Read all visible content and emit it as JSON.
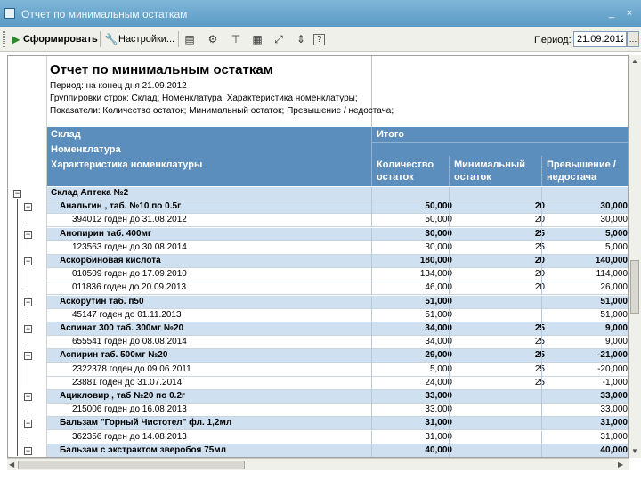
{
  "window": {
    "title": "Отчет по минимальным остаткам",
    "minimize": "_",
    "close": "×"
  },
  "toolbar": {
    "generate_label": "Сформировать",
    "settings_label": "Настройки...",
    "period_label": "Период:",
    "period_value": "21.09.2012"
  },
  "report": {
    "title": "Отчет по минимальным остаткам",
    "period_line": "Период: на конец дня 21.09.2012",
    "grouping_line": "Группировки строк: Склад; Номенклатура; Характеристика номенклатуры;",
    "indicators_line": "Показатели: Количество остаток; Минимальный остаток; Превышение / недостача;",
    "header": {
      "warehouse": "Склад",
      "nomenclature": "Номенклатура",
      "characteristic": "Характеристика номенклатуры",
      "total": "Итого",
      "qty_line1": "Количество",
      "qty_line2": "остаток",
      "min_line1": "Минимальный",
      "min_line2": "остаток",
      "diff_line1": "Превышение /",
      "diff_line2": "недостача"
    },
    "rows": [
      {
        "level": 0,
        "name": "Склад Аптека №2",
        "qty": "",
        "min": "",
        "diff": ""
      },
      {
        "level": 1,
        "name": "Анальгин , таб. №10 по 0.5г",
        "qty": "50,000",
        "min": "20",
        "diff": "30,000"
      },
      {
        "level": 2,
        "name": "394012 годен до 31.08.2012",
        "qty": "50,000",
        "min": "20",
        "diff": "30,000"
      },
      {
        "level": 1,
        "name": "Анопирин таб. 400мг",
        "qty": "30,000",
        "min": "25",
        "diff": "5,000"
      },
      {
        "level": 2,
        "name": "123563 годен до 30.08.2014",
        "qty": "30,000",
        "min": "25",
        "diff": "5,000"
      },
      {
        "level": 1,
        "name": "Аскорбиновая кислота",
        "qty": "180,000",
        "min": "20",
        "diff": "140,000"
      },
      {
        "level": 2,
        "name": "010509 годен до 17.09.2010",
        "qty": "134,000",
        "min": "20",
        "diff": "114,000"
      },
      {
        "level": 2,
        "name": "011836 годен до 20.09.2013",
        "qty": "46,000",
        "min": "20",
        "diff": "26,000"
      },
      {
        "level": 1,
        "name": "Аскорутин таб. п50",
        "qty": "51,000",
        "min": "",
        "diff": "51,000"
      },
      {
        "level": 2,
        "name": "45147 годен до 01.11.2013",
        "qty": "51,000",
        "min": "",
        "diff": "51,000"
      },
      {
        "level": 1,
        "name": "Аспинат 300 таб. 300мг №20",
        "qty": "34,000",
        "min": "25",
        "diff": "9,000"
      },
      {
        "level": 2,
        "name": "655541 годен до 08.08.2014",
        "qty": "34,000",
        "min": "25",
        "diff": "9,000"
      },
      {
        "level": 1,
        "name": "Аспирин таб. 500мг №20",
        "qty": "29,000",
        "min": "25",
        "diff": "-21,000"
      },
      {
        "level": 2,
        "name": "2322378 годен до 09.06.2011",
        "qty": "5,000",
        "min": "25",
        "diff": "-20,000"
      },
      {
        "level": 2,
        "name": "23881 годен до 31.07.2014",
        "qty": "24,000",
        "min": "25",
        "diff": "-1,000"
      },
      {
        "level": 1,
        "name": "Ацикловир , таб №20 по 0.2г",
        "qty": "33,000",
        "min": "",
        "diff": "33,000"
      },
      {
        "level": 2,
        "name": "215006 годен до 16.08.2013",
        "qty": "33,000",
        "min": "",
        "diff": "33,000"
      },
      {
        "level": 1,
        "name": "Бальзам \"Горный Чистотел\" фл. 1,2мл",
        "qty": "31,000",
        "min": "",
        "diff": "31,000"
      },
      {
        "level": 2,
        "name": "362356 годен до 14.08.2013",
        "qty": "31,000",
        "min": "",
        "diff": "31,000"
      },
      {
        "level": 1,
        "name": "Бальзам с экстрактом зверобоя 75мл",
        "qty": "40,000",
        "min": "",
        "diff": "40,000"
      }
    ]
  },
  "colors": {
    "header_bg": "#5b8dbd",
    "group_row_bg": "#cfe1f1",
    "titlebar": "#5a9bc4"
  }
}
